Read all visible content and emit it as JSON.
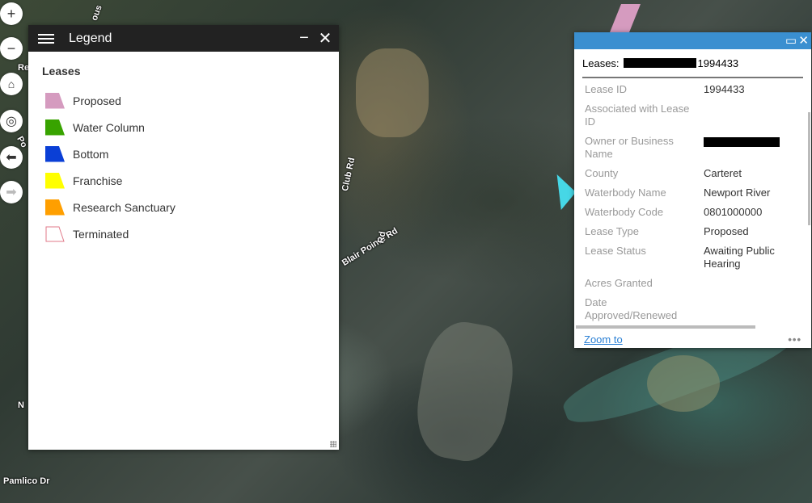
{
  "map": {
    "roads": [
      "Blair Pointe Rd",
      "Club Rd",
      "N",
      "Pamlico Dr",
      "Re",
      "Rd",
      "Po",
      "ous"
    ]
  },
  "map_controls": {
    "zoom_in": "+",
    "zoom_out": "−"
  },
  "legend": {
    "title": "Legend",
    "minimize": "−",
    "close": "✕",
    "group": "Leases",
    "items": [
      {
        "label": "Proposed",
        "color": "#d59bbf"
      },
      {
        "label": "Water Column",
        "color": "#38a300"
      },
      {
        "label": "Bottom",
        "color": "#0a3fd6"
      },
      {
        "label": "Franchise",
        "color": "#ffff00"
      },
      {
        "label": "Research Sanctuary",
        "color": "#ff9f00"
      },
      {
        "label": "Terminated",
        "color": "none"
      }
    ]
  },
  "popup": {
    "title_prefix": "Leases:",
    "title_id": "1994433",
    "fields": [
      {
        "key": "Lease ID",
        "value": "1994433"
      },
      {
        "key": "Associated with Lease ID",
        "value": ""
      },
      {
        "key": "Owner or Business Name",
        "value": ""
      },
      {
        "key": "County",
        "value": "Carteret"
      },
      {
        "key": "Waterbody Name",
        "value": "Newport River"
      },
      {
        "key": "Waterbody Code",
        "value": "0801000000"
      },
      {
        "key": "Lease Type",
        "value": "Proposed"
      },
      {
        "key": "Lease Status",
        "value": "Awaiting Public Hearing"
      },
      {
        "key": "Acres Granted",
        "value": ""
      },
      {
        "key": "Date Approved/Renewed",
        "value": ""
      }
    ],
    "zoom_to": "Zoom to",
    "more": "•••",
    "maximize": "▭",
    "close": "✕"
  }
}
